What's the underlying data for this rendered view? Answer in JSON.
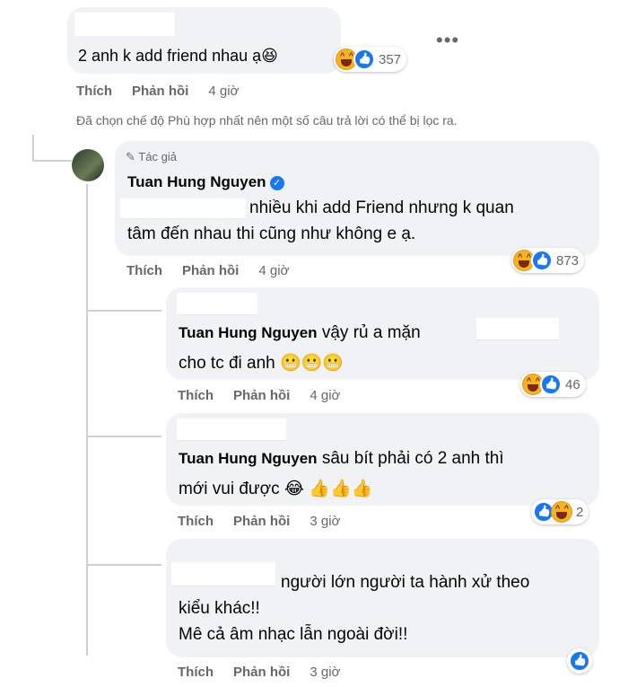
{
  "top_comment": {
    "text": "2 anh k add friend nhau ạ😆",
    "reaction_count": "357",
    "actions": {
      "like": "Thích",
      "reply": "Phản hồi",
      "time": "4 giờ"
    },
    "more_icon": "more-horizontal-icon"
  },
  "filter_notice": "Đã chọn chế độ Phù hợp nhất nên một số câu trả lời có thể bị lọc ra.",
  "author_reply": {
    "badge": "Tác giả",
    "author": "Tuan Hung Nguyen",
    "line1": "nhiều khi add Friend nhưng k quan",
    "line2": "tâm đến nhau thi cũng như không e ạ.",
    "reaction_count": "873",
    "actions": {
      "like": "Thích",
      "reply": "Phản hồi",
      "time": "4 giờ"
    }
  },
  "replies": [
    {
      "mention": "Tuan Hung Nguyen",
      "line1": "vậy rủ a mặn",
      "line2": "cho tc đi anh 😬😬😬",
      "reaction_count": "46",
      "actions": {
        "like": "Thích",
        "reply": "Phản hồi",
        "time": "4 giờ"
      }
    },
    {
      "mention": "Tuan Hung Nguyen",
      "line1": "sâu bít phải có 2 anh thì",
      "line2": "mới vui được 😂 👍👍👍",
      "reaction_count": "2",
      "actions": {
        "like": "Thích",
        "reply": "Phản hồi",
        "time": "3 giờ"
      }
    },
    {
      "line1": "người lớn người ta hành xử theo",
      "line2": "kiểu khác!!",
      "line3": "Mê cả âm nhạc lẫn ngoài đời!!",
      "actions": {
        "like": "Thích",
        "reply": "Phản hồi",
        "time": "3 giờ"
      }
    }
  ],
  "colors": {
    "bubble": "#f0f2f5",
    "meta": "#65676b",
    "accent": "#1877f2"
  }
}
